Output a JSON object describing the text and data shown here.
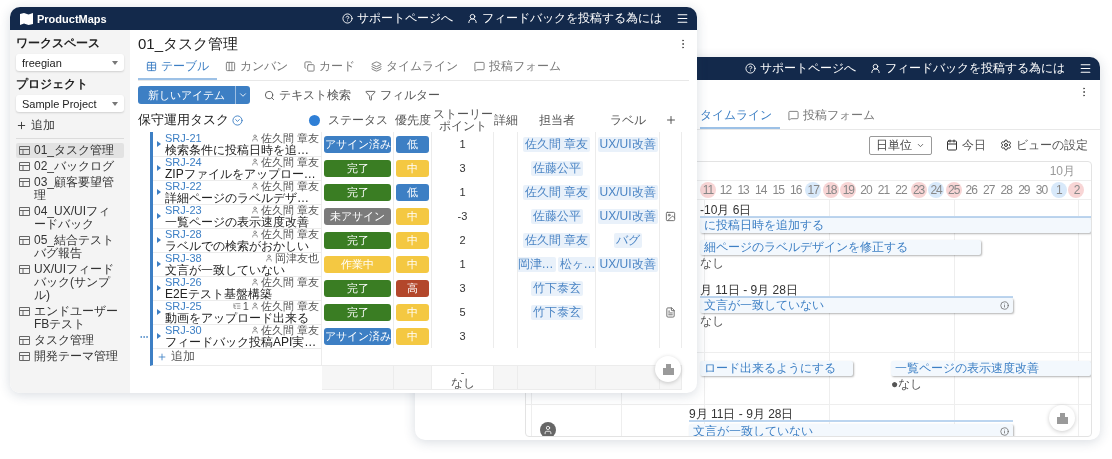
{
  "back_window": {
    "header": {
      "links": [
        {
          "label": "サポートページへ",
          "kind": "help"
        },
        {
          "label": "フィードバックを投稿する為には",
          "kind": "feedback"
        }
      ]
    },
    "tabs": [
      {
        "label": "タイムライン",
        "selected": true
      },
      {
        "label": "投稿フォーム",
        "kind": "form",
        "selected": false
      }
    ],
    "toolbar": {
      "unit": "日単位",
      "today": "今日",
      "settings": "ビューの設定"
    },
    "timeline": {
      "month": "10月",
      "days": [
        {
          "label": "11",
          "color": "#f8d5d5"
        },
        {
          "label": "12"
        },
        {
          "label": "13"
        },
        {
          "label": "14"
        },
        {
          "label": "15"
        },
        {
          "label": "16"
        },
        {
          "label": "17",
          "color": "#d8e9fa"
        },
        {
          "label": "18",
          "color": "#f8d5d5"
        },
        {
          "label": "19",
          "color": "#f8d5d5"
        },
        {
          "label": "20"
        },
        {
          "label": "21"
        },
        {
          "label": "22"
        },
        {
          "label": "23",
          "color": "#f8d5d5"
        },
        {
          "label": "24",
          "color": "#d8e9fa"
        },
        {
          "label": "25",
          "color": "#f8d5d5"
        },
        {
          "label": "26"
        },
        {
          "label": "27"
        },
        {
          "label": "28"
        },
        {
          "label": "29"
        },
        {
          "label": "30"
        },
        {
          "label": "1",
          "color": "#d8e9fa"
        },
        {
          "label": "2",
          "color": "#f8d5d5"
        }
      ],
      "items": [
        {
          "kind": "range",
          "text": "-10月 6日"
        },
        {
          "kind": "bar",
          "text": "に投稿日時を追加する",
          "info": false
        },
        {
          "kind": "bar",
          "text": "細ページのラベルデザインを修正する",
          "info": false
        },
        {
          "kind": "note",
          "text": "なし"
        },
        {
          "kind": "range",
          "text": "月 11日 - 9月 28日"
        },
        {
          "kind": "bar",
          "text": "文言が一致していない",
          "info": true
        },
        {
          "kind": "note",
          "text": "なし"
        },
        {
          "kind": "bar",
          "text": "ロード出来るようにする",
          "info": false
        },
        {
          "kind": "bar",
          "text": "一覧ページの表示速度改善",
          "info": false
        },
        {
          "kind": "note",
          "text": "●なし"
        },
        {
          "kind": "range",
          "text": "9月 11日 - 9月 28日"
        },
        {
          "kind": "bar",
          "text": "文言が一致していない",
          "info": true
        }
      ]
    }
  },
  "front_window": {
    "header": {
      "brand": "ProductMaps",
      "links": [
        {
          "label": "サポートページへ",
          "kind": "help"
        },
        {
          "label": "フィードバックを投稿する為には",
          "kind": "feedback"
        }
      ]
    },
    "sidebar": {
      "workspace_label": "ワークスペース",
      "workspace": "freegian",
      "project_label": "プロジェクト",
      "project": "Sample Project",
      "add": "追加",
      "items": [
        {
          "label": "01_タスク管理",
          "selected": true
        },
        {
          "label": "02_バックログ",
          "selected": false
        },
        {
          "label": "03_顧客要望管理",
          "selected": false
        },
        {
          "label": "04_UX/UIフィードバック",
          "selected": false
        },
        {
          "label": "05_結合テストバグ報告",
          "selected": false
        },
        {
          "label": "UX/UIフィードバック(サンプル)",
          "selected": false
        },
        {
          "label": "エンドユーザーFBテスト",
          "selected": false
        },
        {
          "label": "タスク管理",
          "selected": false
        },
        {
          "label": "開発テーマ管理",
          "selected": false
        }
      ]
    },
    "page_title": "01_タスク管理",
    "tabs": [
      {
        "label": "テーブル",
        "kind": "table",
        "selected": true
      },
      {
        "label": "カンバン",
        "kind": "kanban",
        "selected": false
      },
      {
        "label": "カード",
        "kind": "card",
        "selected": false
      },
      {
        "label": "タイムライン",
        "kind": "timeline",
        "selected": false
      },
      {
        "label": "投稿フォーム",
        "kind": "form",
        "selected": false
      }
    ],
    "toolbar": {
      "new_item": "新しいアイテム",
      "search": "テキスト検索",
      "filter": "フィルター"
    },
    "table": {
      "group": "保守運用タスク",
      "columns": [
        "ステータス",
        "優先度",
        "ストーリーポイント",
        "詳細",
        "担当者",
        "ラベル"
      ],
      "rows": [
        {
          "id": "SRJ-21",
          "owner": "佐久間 章友",
          "title": "検索条件に投稿日時を追…",
          "status": {
            "label": "アサイン済み",
            "color": "#3d7fc4"
          },
          "priority": {
            "label": "低",
            "color": "#3d7fc4"
          },
          "points": "1",
          "assignees": [
            "佐久間 章友"
          ],
          "labels": [
            "UX/UI改善"
          ],
          "hover": false
        },
        {
          "id": "SRJ-24",
          "owner": "佐久間 章友",
          "title": "ZIPファイルをアップロー…",
          "status": {
            "label": "完了",
            "color": "#3a7d23"
          },
          "priority": {
            "label": "中",
            "color": "#f4c842"
          },
          "points": "3",
          "assignees": [
            "佐藤公平"
          ],
          "hover": false
        },
        {
          "id": "SRJ-22",
          "owner": "佐久間 章友",
          "title": "詳細ページのラベルデザ…",
          "status": {
            "label": "完了",
            "color": "#3a7d23"
          },
          "priority": {
            "label": "低",
            "color": "#3d7fc4"
          },
          "points": "1",
          "assignees": [
            "佐久間 章友"
          ],
          "labels": [
            "UX/UI改善"
          ],
          "hover": false
        },
        {
          "id": "SRJ-23",
          "owner": "佐久間 章友",
          "title": "一覧ページの表示速度改善",
          "status": {
            "label": "未アサイン",
            "color": "#7b7b7b"
          },
          "priority": {
            "label": "中",
            "color": "#f4c842"
          },
          "points": "-3",
          "assignees": [
            "佐藤公平"
          ],
          "labels": [
            "UX/UI改善"
          ],
          "attachment": {
            "kind": "image"
          },
          "hover": false
        },
        {
          "id": "SRJ-28",
          "owner": "佐久間 章友",
          "title": "ラベルでの検索がおかしい",
          "status": {
            "label": "完了",
            "color": "#3a7d23"
          },
          "priority": {
            "label": "中",
            "color": "#f4c842"
          },
          "points": "2",
          "assignees": [
            "佐久間 章友"
          ],
          "labels": [
            "バグ"
          ],
          "hover": false
        },
        {
          "id": "SRJ-38",
          "owner": "岡津友也",
          "title": "文言が一致していない",
          "status": {
            "label": "作業中",
            "color": "#f4c842"
          },
          "priority": {
            "label": "中",
            "color": "#f4c842"
          },
          "points": "1",
          "assignees": [
            "岡津…",
            "松ヶ…"
          ],
          "labels": [
            "UX/UI改善"
          ],
          "hover": false
        },
        {
          "id": "SRJ-26",
          "owner": "佐久間 章友",
          "title": "E2Eテスト基盤構築",
          "status": {
            "label": "完了",
            "color": "#3a7d23"
          },
          "priority": {
            "label": "高",
            "color": "#b3472b"
          },
          "points": "3",
          "assignees": [
            "竹下泰玄"
          ],
          "hover": false
        },
        {
          "id": "SRJ-25",
          "subtasks": "1",
          "owner": "佐久間 章友",
          "title": "動画をアップロード出来る",
          "status": {
            "label": "完了",
            "color": "#3a7d23"
          },
          "priority": {
            "label": "中",
            "color": "#f4c842"
          },
          "points": "5",
          "assignees": [
            "竹下泰玄"
          ],
          "attachment": {
            "kind": "document"
          },
          "hover": false
        },
        {
          "id": "SRJ-30",
          "owner": "佐久間 章友",
          "title": "フィードバック投稿API実…",
          "status": {
            "label": "アサイン済み",
            "color": "#3d7fc4"
          },
          "priority": {
            "label": "中",
            "color": "#f4c842"
          },
          "points": "3",
          "hover": true
        }
      ],
      "add_row": "追加",
      "footer": {
        "points_value": "-",
        "points_label": "なし"
      }
    }
  }
}
